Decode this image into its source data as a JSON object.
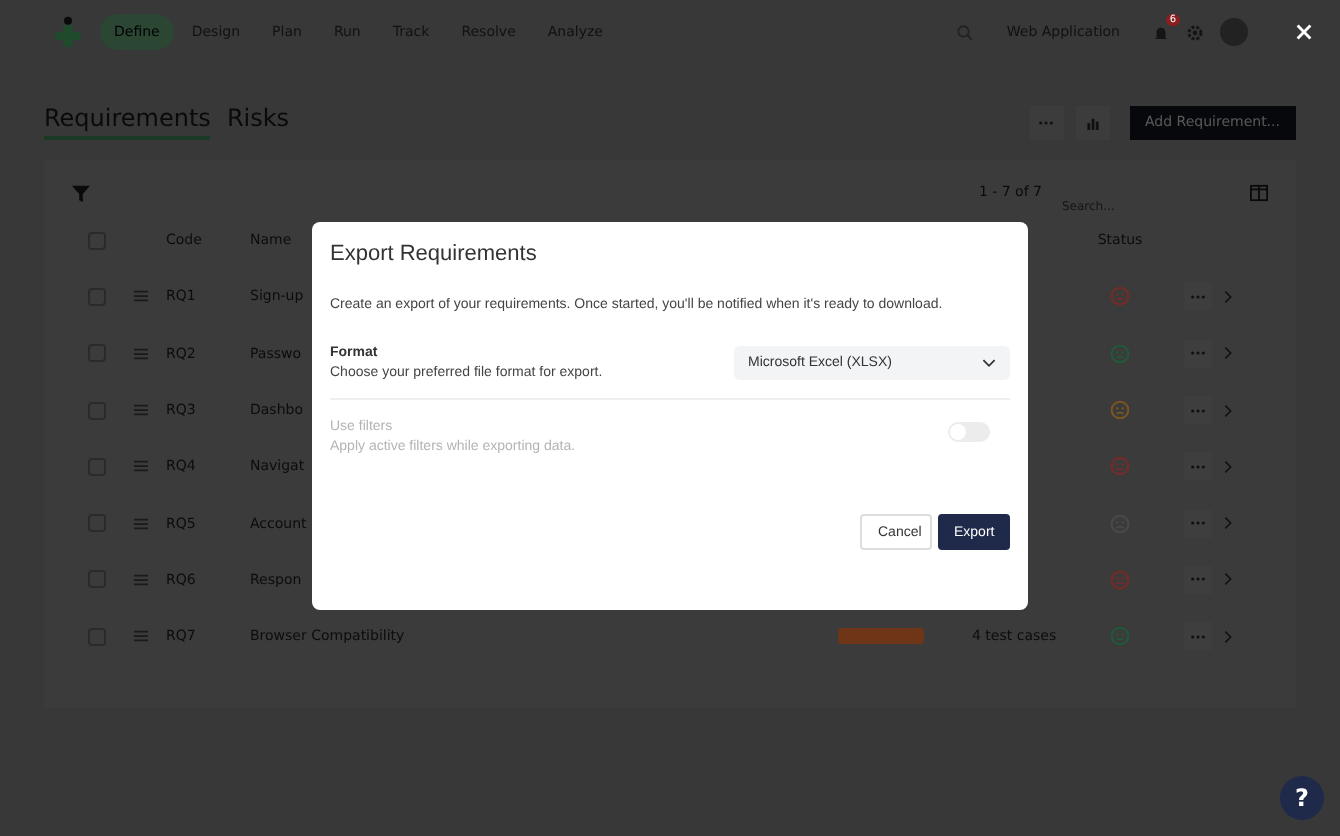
{
  "nav": {
    "tabs": [
      {
        "label": "Define",
        "selected": true
      },
      {
        "label": "Design",
        "selected": false
      },
      {
        "label": "Plan",
        "selected": false
      },
      {
        "label": "Run",
        "selected": false
      },
      {
        "label": "Track",
        "selected": false
      },
      {
        "label": "Resolve",
        "selected": false
      },
      {
        "label": "Analyze",
        "selected": false
      }
    ],
    "project": "Web Application",
    "notifications": "6"
  },
  "page_tabs": [
    {
      "label": "Requirements",
      "selected": true
    },
    {
      "label": "Risks",
      "selected": false
    }
  ],
  "add_button": "Add Requirement...",
  "table": {
    "range": "1 - 7 of 7",
    "search_placeholder": "Search...",
    "select_all_checked": false,
    "columns": [
      "Code",
      "Name",
      "Status"
    ],
    "rows": [
      {
        "checked": false,
        "code": "RQ1",
        "name": "Sign-up",
        "status": {
          "color": "#7a2a26"
        }
      },
      {
        "checked": false,
        "code": "RQ2",
        "name": "Passwo",
        "status": {
          "color": "#1f5a3a"
        }
      },
      {
        "checked": false,
        "code": "RQ3",
        "name": "Dashbo",
        "status": {
          "color": "#7a5520"
        }
      },
      {
        "checked": false,
        "code": "RQ4",
        "name": "Navigat",
        "status": {
          "color": "#7a2a26"
        }
      },
      {
        "checked": false,
        "code": "RQ5",
        "name": "Account",
        "status": {
          "color": "#4a4a4a"
        }
      },
      {
        "checked": false,
        "code": "RQ6",
        "name": "Respon",
        "status": {
          "color": "#7a2a26"
        }
      },
      {
        "checked": false,
        "code": "RQ7",
        "name": "Browser Compatibility",
        "tag": {
          "color": "#6e3617"
        },
        "tests": "4 test cases",
        "status": {
          "color": "#1f5a3a"
        }
      }
    ]
  },
  "dialog": {
    "title": "Export Requirements",
    "intro": "Create an export of your requirements. Once started, you'll be notified when it's ready to download.",
    "format": {
      "label": "Format",
      "hint": "Choose your preferred file format for export.",
      "value": "Microsoft Excel (XLSX)"
    },
    "filters": {
      "label": "Use filters",
      "hint": "Apply active filters while exporting data.",
      "on": false,
      "disabled": true
    },
    "buttons": [
      {
        "label": "Cancel",
        "kind": "secondary"
      },
      {
        "label": "Export",
        "kind": "primary"
      }
    ]
  },
  "help": "?"
}
